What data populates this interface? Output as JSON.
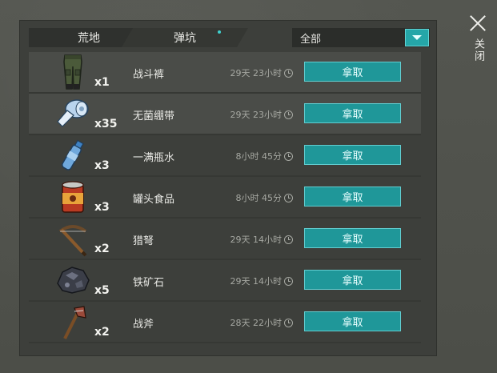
{
  "tabs": [
    {
      "label": "荒地"
    },
    {
      "label": "弹坑"
    }
  ],
  "filter": {
    "label": "全部"
  },
  "close": {
    "label": "关闭"
  },
  "colors": {
    "accent": "#1f9799",
    "accent_border": "#62cdd0",
    "panel": "#3d3f3b",
    "background": "#4f514b"
  },
  "items": [
    {
      "name": "战斗裤",
      "qty": "x1",
      "time": "29天 23小时",
      "button": "拿取",
      "icon": "combat-pants-icon"
    },
    {
      "name": "无菌绷带",
      "qty": "x35",
      "time": "29天 23小时",
      "button": "拿取",
      "icon": "bandage-icon"
    },
    {
      "name": "一满瓶水",
      "qty": "x3",
      "time": "8小时 45分",
      "button": "拿取",
      "icon": "water-bottle-icon"
    },
    {
      "name": "罐头食品",
      "qty": "x3",
      "time": "8小时 45分",
      "button": "拿取",
      "icon": "canned-food-icon"
    },
    {
      "name": "猎弩",
      "qty": "x2",
      "time": "29天 14小时",
      "button": "拿取",
      "icon": "crossbow-icon"
    },
    {
      "name": "铁矿石",
      "qty": "x5",
      "time": "29天 14小时",
      "button": "拿取",
      "icon": "iron-ore-icon"
    },
    {
      "name": "战斧",
      "qty": "x2",
      "time": "28天 22小时",
      "button": "拿取",
      "icon": "battle-axe-icon"
    }
  ]
}
